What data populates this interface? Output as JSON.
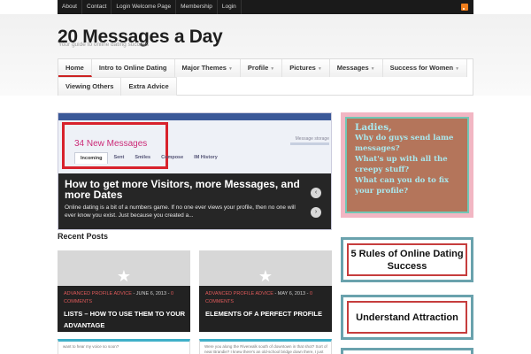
{
  "topnav": {
    "items": [
      "About",
      "Contact",
      "Login Welcome Page",
      "Membership",
      "Login"
    ],
    "rss_icon": "rss-icon"
  },
  "header": {
    "title": "20 Messages a Day",
    "tagline": "Your guide to online dating success"
  },
  "mainnav": {
    "row1": [
      {
        "label": "Home",
        "caret": false
      },
      {
        "label": "Intro to Online Dating",
        "caret": false
      },
      {
        "label": "Major Themes",
        "caret": true
      },
      {
        "label": "Profile",
        "caret": true
      },
      {
        "label": "Pictures",
        "caret": true
      },
      {
        "label": "Messages",
        "caret": true
      },
      {
        "label": "Success for Women",
        "caret": true
      }
    ],
    "row2": [
      {
        "label": "Viewing Others"
      },
      {
        "label": "Extra Advice"
      }
    ],
    "caret_glyph": "▼"
  },
  "slider": {
    "message_count": "34 New Messages",
    "storage_label": "Message storage",
    "tabs": [
      "Incoming",
      "Sent",
      "Smiles",
      "Compose",
      "IM History"
    ],
    "title": "How to get more Visitors, more Messages, and more Dates",
    "excerpt": "Online dating is a bit of a numbers game.  If no one ever views your profile, then no one will ever know you exist.  Just because you created a...",
    "prev_glyph": "‹",
    "next_glyph": "›"
  },
  "recent": {
    "section_title": "Recent Posts",
    "posts": [
      {
        "category": "ADVANCED PROFILE ADVICE",
        "date": " - JUNE 6, 2013 - ",
        "comments": "0 COMMENTS",
        "title": "LISTS – HOW TO USE THEM TO YOUR ADVANTAGE",
        "below": "want to hear my voice so soon?"
      },
      {
        "category": "ADVANCED PROFILE ADVICE",
        "date": " - MAY 6, 2013 - ",
        "comments": "0 COMMENTS",
        "title": "ELEMENTS OF A PERFECT PROFILE",
        "below": "Were you along the Riverwalk south of downtown in that shot? Sort of near Brandie? I knew there's an old-school bridge down there, I just don't remember if it's halfway or after the marina or not"
      }
    ],
    "star_glyph": "★"
  },
  "sidebar": {
    "ladies": {
      "heading": "Ladies,",
      "lines": [
        "Why do guys send lame messages?",
        "What's up with all the creepy stuff?",
        "What can you do to fix your profile?"
      ]
    },
    "rules": "5 Rules of Online Dating Success",
    "attraction": "Understand Attraction"
  }
}
